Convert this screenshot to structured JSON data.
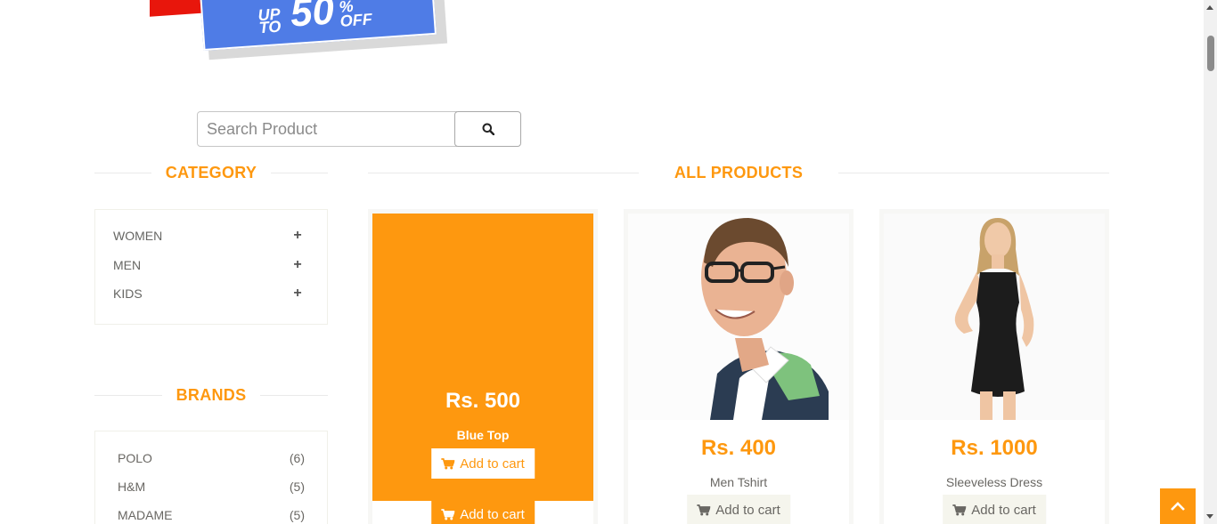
{
  "banner": {
    "line1": "UP",
    "line2": "TO",
    "value": "50",
    "percent": "%",
    "off": "OFF"
  },
  "search": {
    "placeholder": "Search Product",
    "value": ""
  },
  "category": {
    "title": "CATEGORY",
    "items": [
      {
        "label": "WOMEN"
      },
      {
        "label": "MEN"
      },
      {
        "label": "KIDS"
      }
    ]
  },
  "brands": {
    "title": "BRANDS",
    "items": [
      {
        "label": "POLO",
        "count": "(6)"
      },
      {
        "label": "H&M",
        "count": "(5)"
      },
      {
        "label": "MADAME",
        "count": "(5)"
      }
    ]
  },
  "products": {
    "title": "ALL PRODUCTS",
    "items": [
      {
        "price": "Rs. 500",
        "name": "Blue Top",
        "cart_label": "Add to cart",
        "overlay_cart_label": "Add to cart"
      },
      {
        "price": "Rs. 400",
        "name": "Men Tshirt",
        "cart_label": "Add to cart"
      },
      {
        "price": "Rs. 1000",
        "name": "Sleeveless Dress",
        "cart_label": "Add to cart"
      }
    ]
  },
  "colors": {
    "accent": "#fe980f",
    "banner_blue": "#4f7ce6",
    "banner_red": "#e8160c"
  },
  "icons": {
    "search": "search-icon",
    "plus": "plus-icon",
    "cart": "shopping-cart-icon",
    "scroll_up": "chevron-up-icon"
  }
}
